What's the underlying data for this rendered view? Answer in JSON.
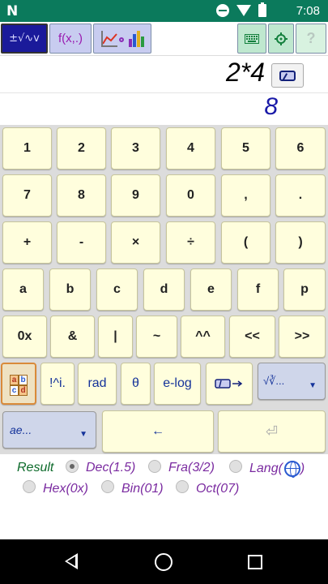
{
  "status_bar": {
    "time": "7:08",
    "icons": [
      "n-icon",
      "do-not-disturb-icon",
      "wifi-icon",
      "battery-icon"
    ]
  },
  "toolbar": {
    "calc_label": "±√∿v",
    "fx_label": "f(x,.)",
    "graph_icon": "graph-chart-icon",
    "keyboard_icon": "keyboard-icon",
    "settings_icon": "gear-icon",
    "help_label": "?"
  },
  "display": {
    "expression": "2*4",
    "result": "8",
    "clear_icon": "eraser-icon"
  },
  "keypad": {
    "row1": [
      "1",
      "2",
      "3",
      "4",
      "5",
      "6"
    ],
    "row2": [
      "7",
      "8",
      "9",
      "0",
      ",",
      "."
    ],
    "row3": [
      "+",
      "-",
      "×",
      "÷",
      "(",
      ")"
    ],
    "row4": [
      "a",
      "b",
      "c",
      "d",
      "e",
      "f",
      "p"
    ],
    "row5": [
      "0x",
      "&",
      "|",
      "~",
      "^^",
      "<<",
      ">>"
    ],
    "row6": {
      "abc_icon": "abc-letters-icon",
      "fact": "!^i.",
      "rad": "rad",
      "theta": "θ",
      "elog": "e-log",
      "clear_arrow_icon": "eraser-arrow-icon",
      "func_select": "√∛...",
      "func_select_arrow": "▼"
    },
    "row7": {
      "var_select": "ae...",
      "var_select_arrow": "▼",
      "backspace": "←",
      "enter": "⏎"
    },
    "colors": {
      "key_bg": "#fffedd",
      "key_text_blue": "#15339a"
    }
  },
  "options": {
    "result_label": "Result",
    "radios": [
      {
        "label": "Dec(1.5)",
        "selected": true
      },
      {
        "label": "Fra(3/2)",
        "selected": false
      },
      {
        "label": "Lang(",
        "selected": false
      },
      {
        "label": "Hex(0x)",
        "selected": false
      },
      {
        "label": "Bin(01)",
        "selected": false
      },
      {
        "label": "Oct(07)",
        "selected": false
      }
    ],
    "lang_close": ")",
    "lang_icon": "globe-icon"
  },
  "nav_bar": {
    "back_icon": "back-icon",
    "home_icon": "home-icon",
    "recents_icon": "recents-icon"
  }
}
